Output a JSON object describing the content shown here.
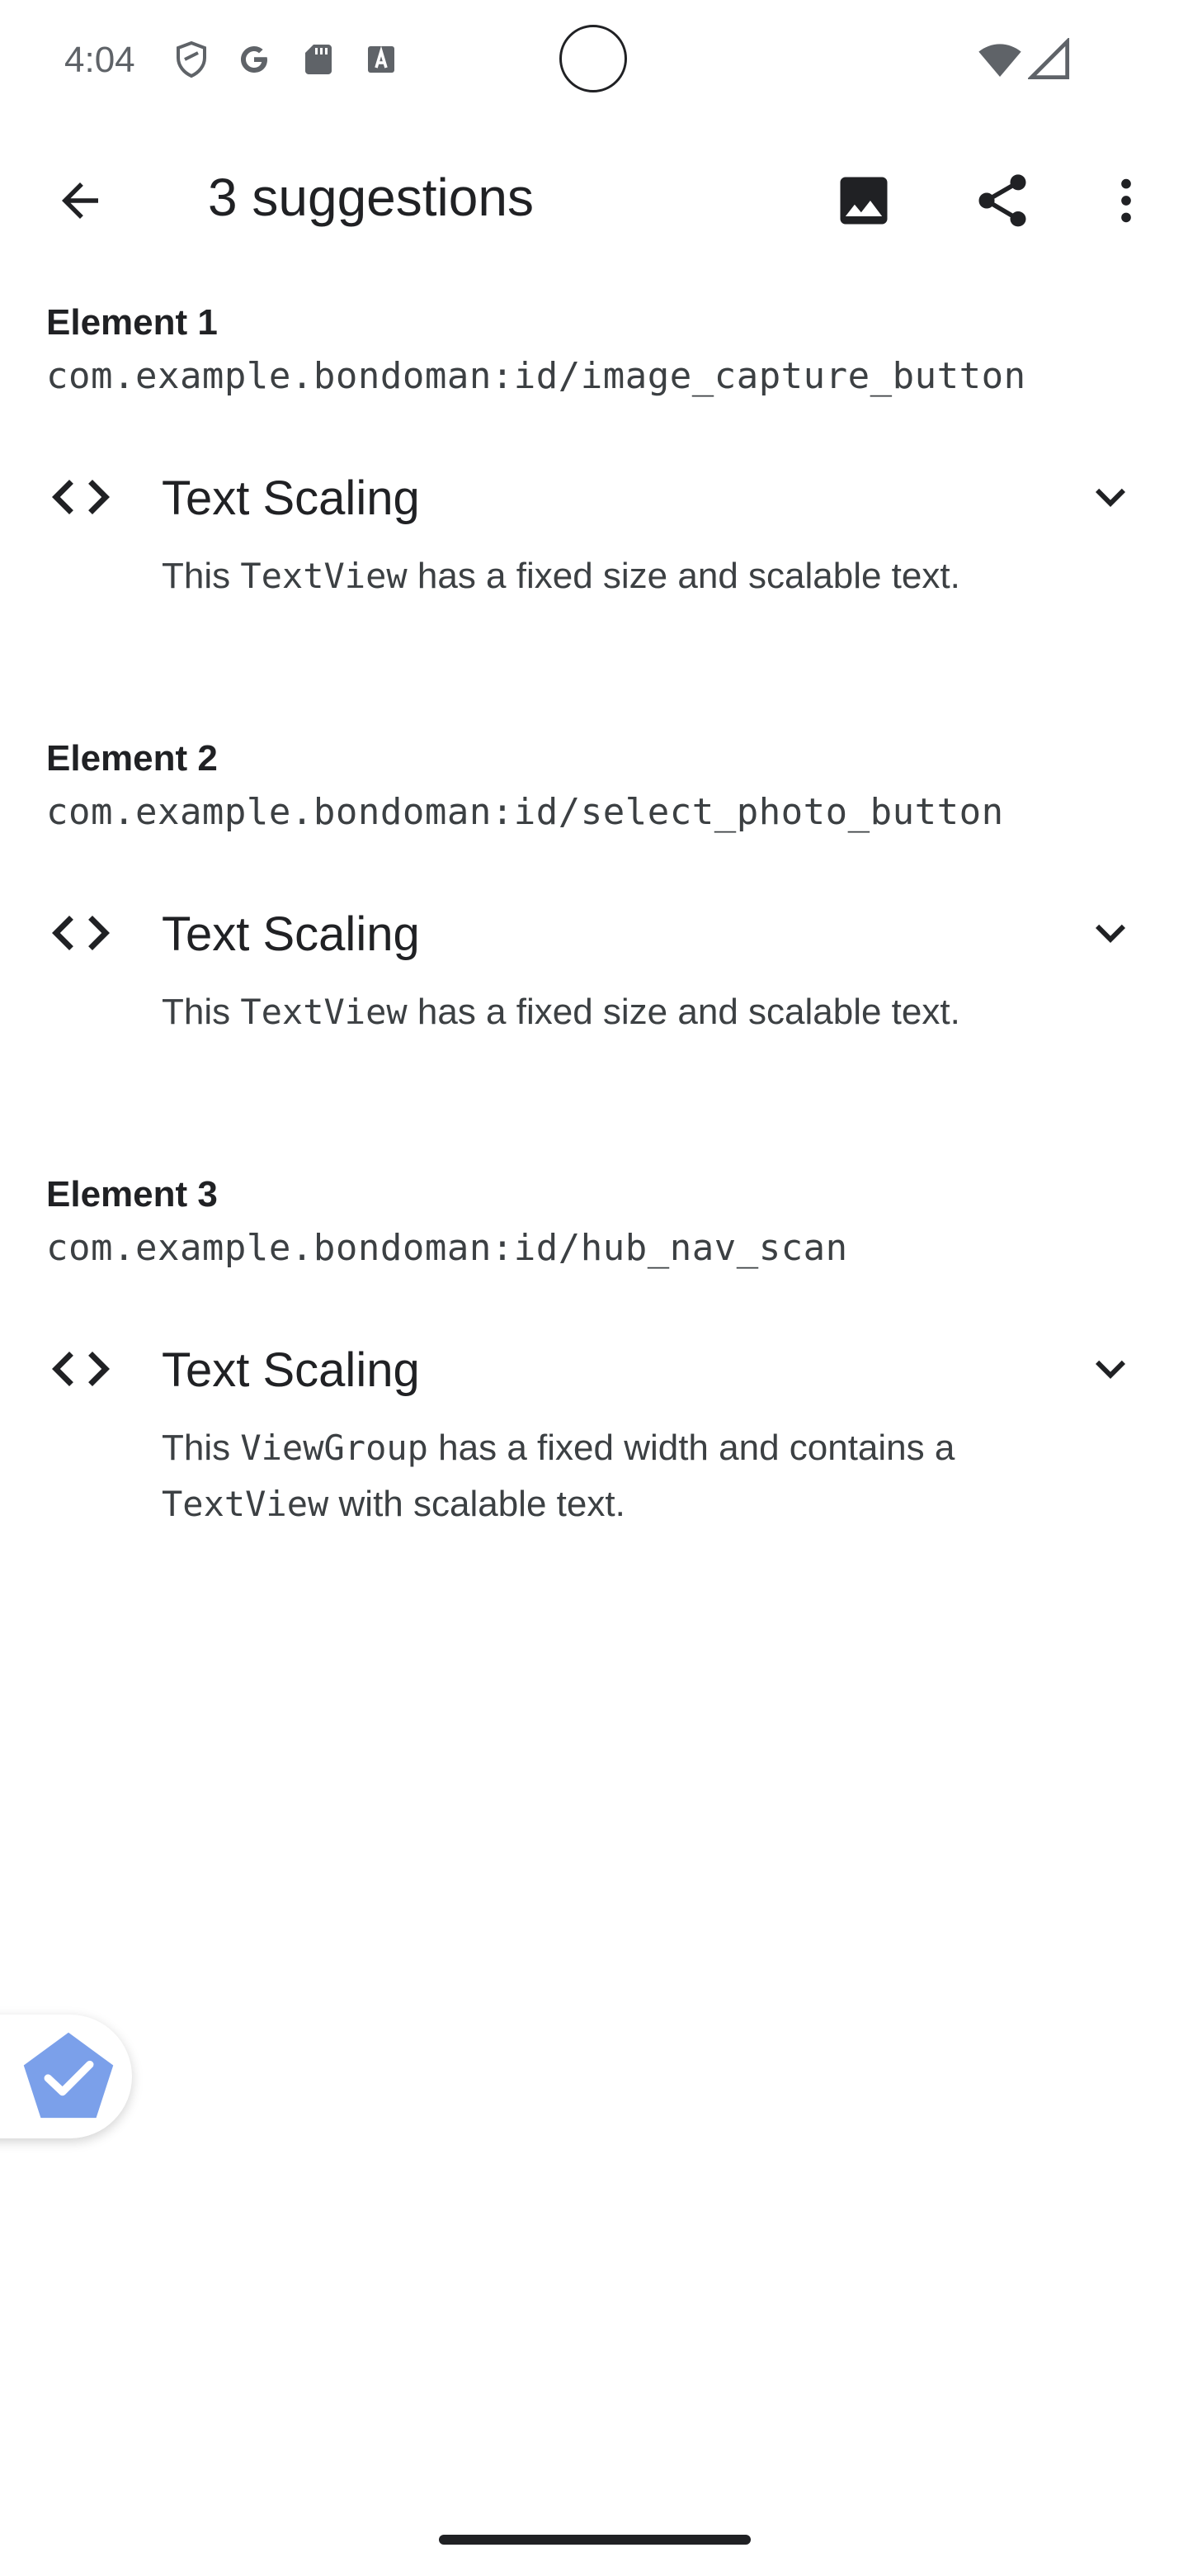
{
  "status_bar": {
    "time": "4:04",
    "icons_left": [
      "shield-icon",
      "google-icon",
      "sd-card-icon",
      "font-icon"
    ],
    "icons_right": [
      "wifi-icon",
      "cell-signal-icon"
    ]
  },
  "toolbar": {
    "title": "3 suggestions",
    "back_icon": "arrow-back-icon",
    "actions": [
      "image-icon",
      "share-icon",
      "more-vert-icon"
    ]
  },
  "elements": [
    {
      "heading": "Element 1",
      "id": "com.example.bondoman:id/image_capture_button",
      "suggestion": {
        "title": "Text Scaling",
        "desc_pre": "This ",
        "desc_code": "TextView",
        "desc_post": " has a fixed size and scalable text."
      }
    },
    {
      "heading": "Element 2",
      "id": "com.example.bondoman:id/select_photo_button",
      "suggestion": {
        "title": "Text Scaling",
        "desc_pre": "This ",
        "desc_code": "TextView",
        "desc_post": " has a fixed size and scalable text."
      }
    },
    {
      "heading": "Element 3",
      "id": "com.example.bondoman:id/hub_nav_scan",
      "suggestion": {
        "title": "Text Scaling",
        "desc_pre": "This ",
        "desc_code": "ViewGroup",
        "desc_mid": " has a fixed width and contains a ",
        "desc_code2": "TextView",
        "desc_post": " with scalable text."
      }
    }
  ],
  "colors": {
    "text_primary": "#202124",
    "text_secondary": "#3c4043",
    "badge_blue": "#7ba0ea"
  }
}
